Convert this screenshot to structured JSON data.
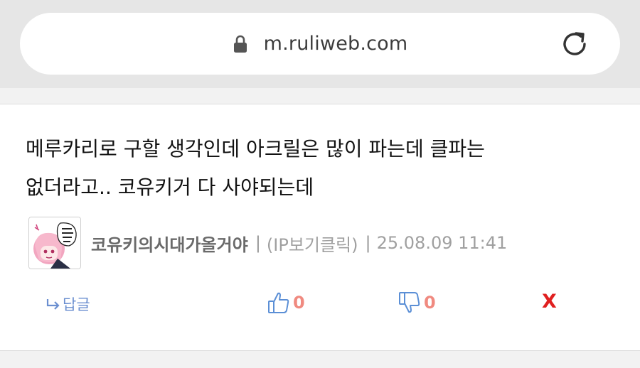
{
  "browser": {
    "url": "m.ruliweb.com",
    "lock_icon": "lock-icon",
    "reload_icon": "reload-icon"
  },
  "comment": {
    "text_line1": "메루카리로 구할 생각인데 아크릴은 많이 파는데 클파는",
    "text_line2": "없더라고.. 코유키거 다 사야되는데",
    "author": "코유키의시대가올거야",
    "separator": "|",
    "ip": "(IP보기클릭)",
    "datetime": "25.08.09 11:41",
    "avatar_icon": "avatar"
  },
  "actions": {
    "reply_label": "답글",
    "likes": "0",
    "dislikes": "0",
    "delete_label": "X"
  },
  "colors": {
    "reply": "#6b8fd0",
    "count": "#f08a80",
    "delete": "#e02020",
    "nickname": "#6a6a6a"
  }
}
